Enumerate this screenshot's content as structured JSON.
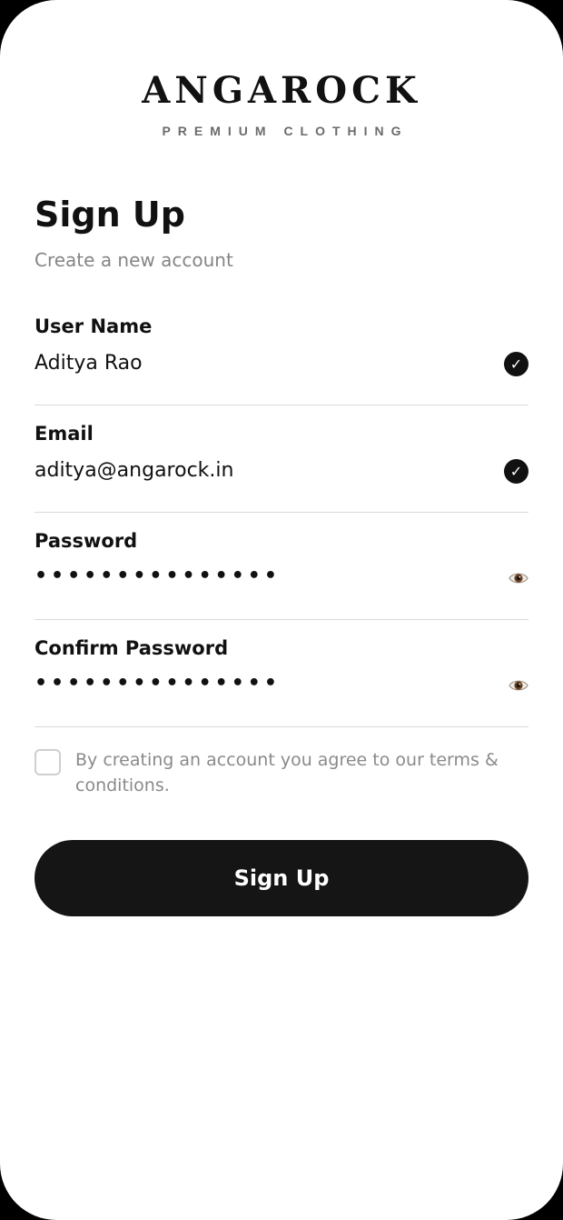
{
  "brand": {
    "name": "ANGAROCK",
    "tagline": "PREMIUM CLOTHING"
  },
  "header": {
    "title": "Sign Up",
    "subtitle": "Create a new account"
  },
  "form": {
    "username": {
      "label": "User Name",
      "value": "Aditya Rao",
      "status_icon": "check-circle-icon"
    },
    "email": {
      "label": "Email",
      "value": "aditya@angarock.in",
      "status_icon": "check-circle-icon"
    },
    "password": {
      "label": "Password",
      "masked_value": "•••••••••••••••",
      "toggle_icon": "eye-icon"
    },
    "confirm_password": {
      "label": "Confirm Password",
      "masked_value": "•••••••••••••••",
      "toggle_icon": "eye-icon"
    },
    "terms": {
      "checked": false,
      "text": "By creating an account you agree to our terms & conditions."
    },
    "submit_label": "Sign Up"
  },
  "colors": {
    "primary": "#151515",
    "muted_text": "#858585",
    "divider": "#d9d9d9",
    "background": "#ffffff"
  }
}
